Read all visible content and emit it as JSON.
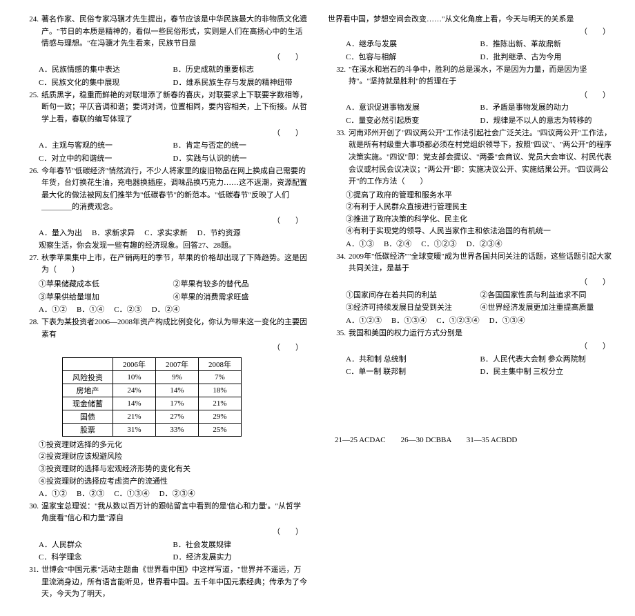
{
  "left": {
    "q24": {
      "num": "24.",
      "text": "著名作家、民俗专家冯骥才先生提出，春节应该是中华民族最大的非物质文化遗产。\"节日的本质是精神的，看似一些民俗形式，实则是人们在高扬心中的生活情感与理想。\"在冯骥才先生看来，民族节日是",
      "br": "（　　）",
      "A": "A．民族情感的集中表达",
      "B": "B．历史成就的重要标志",
      "C": "C．民族文化的集中展现",
      "D": "D．维系民族生存与发展的精神纽带"
    },
    "q25": {
      "num": "25.",
      "text": "纸质黑字，稳重而鲜艳的对联增添了新春的喜庆，对联要求上下联要字数相等，断句一致；平仄音调和谐；要词对词，位置相同，要内容相关，上下衔接。从哲学上看，春联的编写体现了",
      "br": "（　　）",
      "A": "A．主观与客观的统一",
      "B": "B．肯定与否定的统一",
      "C": "C．对立中的和谐统一",
      "D": "D．实践与认识的统一"
    },
    "q26": {
      "num": "26.",
      "text": "今年春节\"低碳经济\"悄然流行，不少人将家里的废旧物品在网上换成自己需要的年货，台灯换花生油，充电器换插座，调味品换巧克力……这不返潮，资源配置最大化的做法被网友们推举为\"低碳春节\"的新范本。\"低碳春节\"反映了人们________的消费观念。",
      "br": "（　　）",
      "A": "A．量入为出",
      "B": "B．求新求异",
      "C": "C．求实求新",
      "D": "D．节约资源"
    },
    "intro27": "观察生活，你会发现一些有趣的经济现象。回答27、28题。",
    "q27": {
      "num": "27.",
      "text": "秋季苹果集中上市，在产销两旺的季节，苹果的价格却出现了下降趋势。这是因为（　　）",
      "l1": "①苹果储藏成本低",
      "l2": "②苹果有较多的替代品",
      "l3": "③苹果供给量增加",
      "l4": "④苹果的消费需求旺盛",
      "A": "A．①②",
      "B": "B．①④",
      "C": "C．②③",
      "D": "D．②④"
    },
    "q28": {
      "num": "28.",
      "text": "下表为某投资者2006—2008年资产构成比例变化，你认为带来这一变化的主要因素有",
      "br": "（　　）",
      "table": {
        "h": [
          "",
          "2006年",
          "2007年",
          "2008年"
        ],
        "rows": [
          [
            "风险投资",
            "10%",
            "9%",
            "7%"
          ],
          [
            "房地产",
            "24%",
            "14%",
            "18%"
          ],
          [
            "现金储蓄",
            "14%",
            "17%",
            "21%"
          ],
          [
            "国债",
            "21%",
            "27%",
            "29%"
          ],
          [
            "股票",
            "31%",
            "33%",
            "25%"
          ]
        ]
      },
      "l1": "①投资理财选择的多元化",
      "l2": "②投资理财应该规避风险",
      "l3": "③投资理财的选择与宏观经济形势的变化有关",
      "l4": "④投资理财的选择应考虑资产的流通性",
      "A": "A．①②",
      "B": "B．②③",
      "C": "C．①③④",
      "D": "D．②③④"
    },
    "q30": {
      "num": "30.",
      "text": "温家宝总理说：\"我从数以百万计的跟帖留言中看到的是'信心和力量'。\"从哲学角度看\"信心和力量\"源自",
      "br": "（　　）",
      "A": "A．人民群众",
      "B": "B．社会发展规律",
      "C": "C．科学理念",
      "D": "D．经济发展实力"
    },
    "q31": {
      "num": "31.",
      "text": "世博会\"中国元素\"活动主题曲《世界看中国》中这样写道，\"世界并不遥远，万里流淌身边，所有语言能听见，世界看中国。五千年中国元素经典；传承为了今天，今天为了明天，"
    }
  },
  "right": {
    "q31c": {
      "text": "世界看中国，梦想空间会改变……\"从文化角度上看，今天与明天的关系是",
      "br": "（　　）",
      "A": "A．继承与发展",
      "B": "B．推陈出新、革故鼎新",
      "C": "C．包容与相解",
      "D": "D．批判继承、古为今用"
    },
    "q32": {
      "num": "32.",
      "text": "\"在溪水和岩石的斗争中，胜利的总是溪水，不是因为力量，而是因为坚持\"。\"坚持就是胜利\"的哲理在于",
      "br": "（　　）",
      "A": "A．意识促进事物发展",
      "B": "B．矛盾是事物发展的动力",
      "C": "C．量变必然引起质变",
      "D": "D．规律是不以人的意志为转移的"
    },
    "q33": {
      "num": "33.",
      "text": "河南邓州开创了\"四议两公开\"工作法引起社会广泛关注。\"四议两公开\"工作法，就是所有村级重大事项都必须在村党组织领导下，按照\"四议\"、\"两公开\"的程序决策实施。\"四议\"即：党支部会提议、\"两委\"会商议、党员大会审议、村民代表会议或村民会议决议；\"两公开\"即：实施决议公开、实施结果公开。\"四议两公开\"的工作方法（　　）",
      "l1": "①提高了政府的管理和服务水平",
      "l2": "②有利于人民群众直接进行管理民主",
      "l3": "③推进了政府决策的科学化、民主化",
      "l4": "④有利于实现党的领导、人民当家作主和依法治国的有机统一",
      "A": "A．①③",
      "B": "B．②④",
      "C": "C．①②③",
      "D": "D．②③④"
    },
    "q34": {
      "num": "34.",
      "text": "2009年\"低碳经济\"\"全球变暖\"成为世界各国共同关注的话题，这些话题引起大家共同关注，是基于",
      "br": "（　　）",
      "l1": "①国家间存在着共同的利益",
      "l2": "②各国国家性质与利益追求不同",
      "l3": "③经济可持续发展日益受到关注",
      "l4": "④世界经济发展更加注重提高质量",
      "A": "A．①②③",
      "B": "B．①③④",
      "C": "C．①②③④",
      "D": "D．①③④"
    },
    "q35": {
      "num": "35.",
      "text": "我国和美国的权力运行方式分别是",
      "br": "（　　）",
      "A": "A．共和制 总统制",
      "B": "B．人民代表大会制 参众两院制",
      "C": "C．单一制 联邦制",
      "D": "D．民主集中制 三权分立"
    }
  },
  "answers": "21—25 ACDAC　　26—30 DCBBA　　31—35 ACBDD"
}
